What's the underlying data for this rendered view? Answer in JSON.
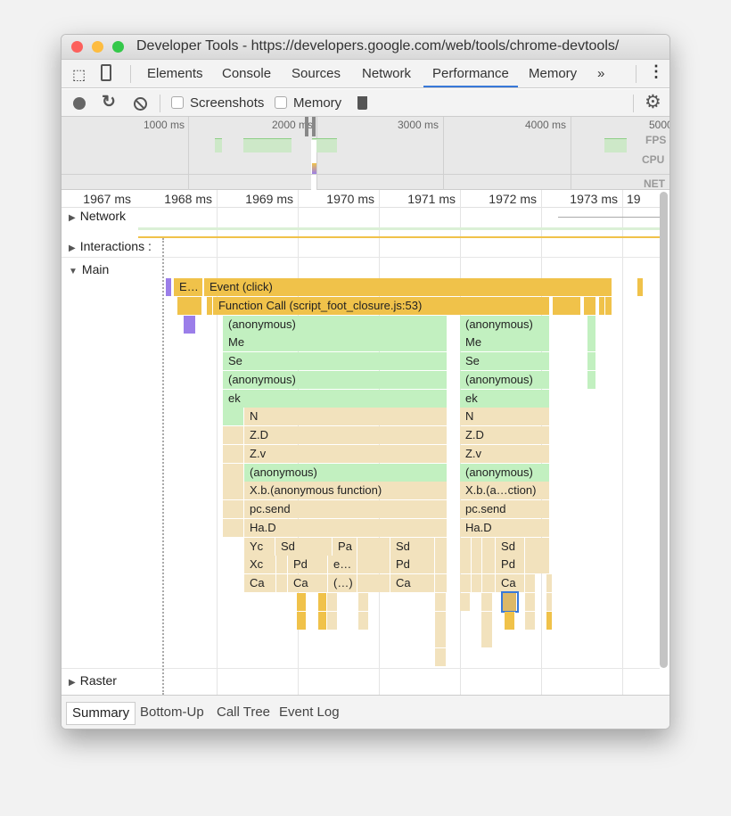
{
  "window": {
    "title": "Developer Tools - https://developers.google.com/web/tools/chrome-devtools/"
  },
  "tabs": [
    {
      "label": "Elements"
    },
    {
      "label": "Console"
    },
    {
      "label": "Sources"
    },
    {
      "label": "Network"
    },
    {
      "label": "Performance",
      "active": true
    },
    {
      "label": "Memory"
    }
  ],
  "tabs_more": "»",
  "toolbar": {
    "screenshots_label": "Screenshots",
    "screenshots_checked": false,
    "memory_label": "Memory",
    "memory_checked": false
  },
  "overview": {
    "ticks": [
      "1000 ms",
      "2000 ms",
      "3000 ms",
      "4000 ms",
      "5000"
    ],
    "labels": {
      "fps": "FPS",
      "cpu": "CPU",
      "net": "NET"
    }
  },
  "ruler": {
    "ticks": [
      "1967 ms",
      "1968 ms",
      "1969 ms",
      "1970 ms",
      "1971 ms",
      "1972 ms",
      "1973 ms",
      "19"
    ]
  },
  "tracks": {
    "network": "Network",
    "interactions": "Interactions :",
    "main": "Main",
    "raster": "Raster"
  },
  "colors": {
    "gold": "#f0c24a",
    "tan": "#f2e2bd",
    "green": "#c2f0c0",
    "purple": "#9b7ee9",
    "selected": "#dcb867",
    "accent": "#3879d9"
  },
  "flame": {
    "time_unit": "ms",
    "rows": [
      [
        [
          1967.363,
          1967.407,
          "purple",
          ""
        ],
        [
          1967.462,
          1967.824,
          "gold",
          "E…"
        ],
        [
          1967.835,
          1972.868,
          "gold",
          "Event (click)"
        ],
        [
          1973.176,
          1973.22,
          "gold",
          ""
        ]
      ],
      [
        [
          1967.505,
          1967.813,
          "gold",
          ""
        ],
        [
          1967.868,
          1967.945,
          "gold",
          ""
        ],
        [
          1967.945,
          1972.099,
          "gold",
          "Function Call (script_foot_closure.js:53)"
        ],
        [
          1972.132,
          1972.484,
          "gold",
          ""
        ],
        [
          1972.516,
          1972.67,
          "gold",
          ""
        ],
        [
          1972.703,
          1972.758,
          "gold",
          ""
        ],
        [
          1972.78,
          1972.868,
          "gold",
          ""
        ]
      ],
      [
        [
          1967.582,
          1967.736,
          "purple",
          ""
        ],
        [
          1968.066,
          1970.835,
          "green",
          "(anonymous)"
        ],
        [
          1970.989,
          1972.099,
          "green",
          "(anonymous)"
        ],
        [
          1972.56,
          1972.67,
          "green",
          ""
        ]
      ],
      [
        [
          1968.066,
          1970.835,
          "green",
          "Me"
        ],
        [
          1970.989,
          1972.099,
          "green",
          "Me"
        ],
        [
          1972.56,
          1972.67,
          "green",
          ""
        ]
      ],
      [
        [
          1968.066,
          1970.835,
          "green",
          "Se"
        ],
        [
          1970.989,
          1972.099,
          "green",
          "Se"
        ],
        [
          1972.56,
          1972.67,
          "green",
          ""
        ]
      ],
      [
        [
          1968.066,
          1970.835,
          "green",
          "(anonymous)"
        ],
        [
          1970.989,
          1972.099,
          "green",
          "(anonymous)"
        ],
        [
          1972.56,
          1972.67,
          "green",
          ""
        ]
      ],
      [
        [
          1968.066,
          1970.835,
          "green",
          "ek"
        ],
        [
          1970.989,
          1972.099,
          "green",
          "ek"
        ]
      ],
      [
        [
          1968.066,
          1968.33,
          "green",
          ""
        ],
        [
          1968.33,
          1970.835,
          "tan",
          "N"
        ],
        [
          1970.989,
          1972.099,
          "tan",
          "N"
        ]
      ],
      [
        [
          1968.066,
          1968.33,
          "tan",
          ""
        ],
        [
          1968.33,
          1970.835,
          "tan",
          "Z.D"
        ],
        [
          1970.989,
          1972.099,
          "tan",
          "Z.D"
        ]
      ],
      [
        [
          1968.066,
          1968.33,
          "tan",
          ""
        ],
        [
          1968.33,
          1970.835,
          "tan",
          "Z.v"
        ],
        [
          1970.989,
          1972.099,
          "tan",
          "Z.v"
        ]
      ],
      [
        [
          1968.066,
          1968.33,
          "tan",
          ""
        ],
        [
          1968.33,
          1970.835,
          "green",
          "(anonymous)"
        ],
        [
          1970.989,
          1972.099,
          "green",
          "(anonymous)"
        ]
      ],
      [
        [
          1968.066,
          1968.33,
          "tan",
          ""
        ],
        [
          1968.33,
          1970.835,
          "tan",
          "X.b.(anonymous function)"
        ],
        [
          1970.989,
          1972.099,
          "tan",
          "X.b.(a…ction)"
        ]
      ],
      [
        [
          1968.066,
          1968.33,
          "tan",
          ""
        ],
        [
          1968.33,
          1970.835,
          "tan",
          "pc.send"
        ],
        [
          1970.989,
          1972.099,
          "tan",
          "pc.send"
        ]
      ],
      [
        [
          1968.066,
          1968.33,
          "tan",
          ""
        ],
        [
          1968.33,
          1970.835,
          "tan",
          "Ha.D"
        ],
        [
          1970.989,
          1972.099,
          "tan",
          "Ha.D"
        ]
      ],
      [
        [
          1968.33,
          1968.714,
          "tan",
          "Yc"
        ],
        [
          1968.714,
          1969.418,
          "tan",
          "Sd"
        ],
        [
          1969.418,
          1969.725,
          "tan",
          "Pa"
        ],
        [
          1969.725,
          1970.132,
          "tan",
          ""
        ],
        [
          1970.132,
          1970.681,
          "tan",
          "Sd"
        ],
        [
          1970.681,
          1970.835,
          "tan",
          ""
        ],
        [
          1970.989,
          1971.132,
          "tan",
          ""
        ],
        [
          1971.132,
          1971.264,
          "tan",
          ""
        ],
        [
          1971.264,
          1971.429,
          "tan",
          ""
        ],
        [
          1971.429,
          1971.791,
          "tan",
          "Sd"
        ],
        [
          1971.791,
          1972.099,
          "tan",
          ""
        ]
      ],
      [
        [
          1968.33,
          1968.725,
          "tan",
          "Xc"
        ],
        [
          1968.725,
          1968.868,
          "tan",
          ""
        ],
        [
          1968.868,
          1969.363,
          "tan",
          "Pd"
        ],
        [
          1969.363,
          1969.725,
          "tan",
          "e…"
        ],
        [
          1969.725,
          1970.132,
          "tan",
          ""
        ],
        [
          1970.132,
          1970.681,
          "tan",
          "Pd"
        ],
        [
          1970.681,
          1970.835,
          "tan",
          ""
        ],
        [
          1970.989,
          1971.132,
          "tan",
          ""
        ],
        [
          1971.132,
          1971.264,
          "tan",
          ""
        ],
        [
          1971.264,
          1971.429,
          "tan",
          ""
        ],
        [
          1971.429,
          1971.791,
          "tan",
          "Pd"
        ],
        [
          1971.791,
          1972.099,
          "tan",
          ""
        ]
      ],
      [
        [
          1968.33,
          1968.725,
          "tan",
          "Ca"
        ],
        [
          1968.725,
          1968.868,
          "tan",
          ""
        ],
        [
          1968.868,
          1969.363,
          "tan",
          "Ca"
        ],
        [
          1969.363,
          1969.725,
          "tan",
          "(…)"
        ],
        [
          1969.725,
          1970.132,
          "tan",
          ""
        ],
        [
          1970.132,
          1970.681,
          "tan",
          "Ca"
        ],
        [
          1970.681,
          1970.835,
          "tan",
          ""
        ],
        [
          1970.989,
          1971.132,
          "tan",
          ""
        ],
        [
          1971.132,
          1971.264,
          "tan",
          ""
        ],
        [
          1971.264,
          1971.429,
          "tan",
          ""
        ],
        [
          1971.429,
          1971.791,
          "tan",
          "Ca"
        ],
        [
          1971.791,
          1971.923,
          "tan",
          ""
        ],
        [
          1972.055,
          1972.099,
          "tan",
          ""
        ]
      ],
      [
        [
          1968.978,
          1969.099,
          "gold",
          ""
        ],
        [
          1969.242,
          1969.352,
          "gold",
          ""
        ],
        [
          1969.352,
          1969.484,
          "tan",
          ""
        ],
        [
          1969.736,
          1969.868,
          "tan",
          ""
        ],
        [
          1970.681,
          1970.824,
          "tan",
          ""
        ],
        [
          1970.989,
          1971.121,
          "tan",
          ""
        ],
        [
          1971.253,
          1971.396,
          "tan",
          ""
        ],
        [
          1971.516,
          1971.692,
          "selected",
          ""
        ],
        [
          1971.791,
          1971.923,
          "tan",
          ""
        ],
        [
          1972.055,
          1972.099,
          "tan",
          ""
        ]
      ],
      [
        [
          1968.978,
          1969.099,
          "gold",
          ""
        ],
        [
          1969.242,
          1969.352,
          "gold",
          ""
        ],
        [
          1969.352,
          1969.484,
          "tan",
          ""
        ],
        [
          1969.736,
          1969.868,
          "tan",
          ""
        ],
        [
          1970.681,
          1970.824,
          "tan",
          ""
        ],
        [
          1971.253,
          1971.396,
          "tan",
          ""
        ],
        [
          1971.538,
          1971.67,
          "gold",
          ""
        ],
        [
          1971.791,
          1971.923,
          "tan",
          ""
        ],
        [
          1972.055,
          1972.099,
          "gold",
          ""
        ]
      ],
      [
        [
          1970.681,
          1970.824,
          "tan",
          ""
        ],
        [
          1971.253,
          1971.396,
          "tan",
          ""
        ]
      ],
      [
        [
          1970.681,
          1970.824,
          "tan",
          ""
        ]
      ]
    ]
  },
  "bottom_tabs": [
    {
      "label": "Summary",
      "active": true
    },
    {
      "label": "Bottom-Up"
    },
    {
      "label": "Call Tree"
    },
    {
      "label": "Event Log"
    }
  ]
}
